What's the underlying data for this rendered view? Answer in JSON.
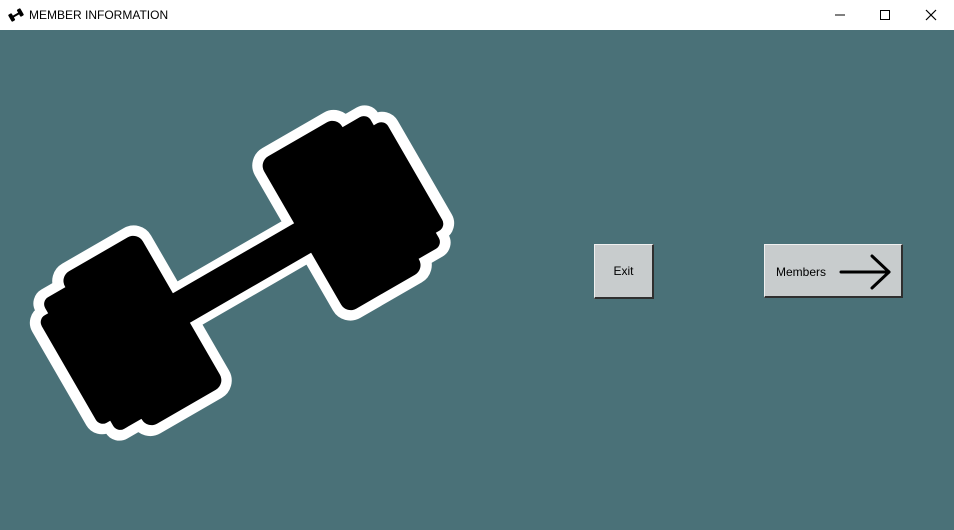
{
  "window": {
    "title": "MEMBER INFORMATION",
    "controls": {
      "minimize_icon": "minimize-icon",
      "maximize_icon": "maximize-icon",
      "close_icon": "close-icon"
    }
  },
  "content": {
    "background_color": "#4a7178",
    "image_icon": "dumbbell-icon",
    "buttons": {
      "exit_label": "Exit",
      "members_label": "Members",
      "members_icon": "arrow-right-icon"
    }
  }
}
